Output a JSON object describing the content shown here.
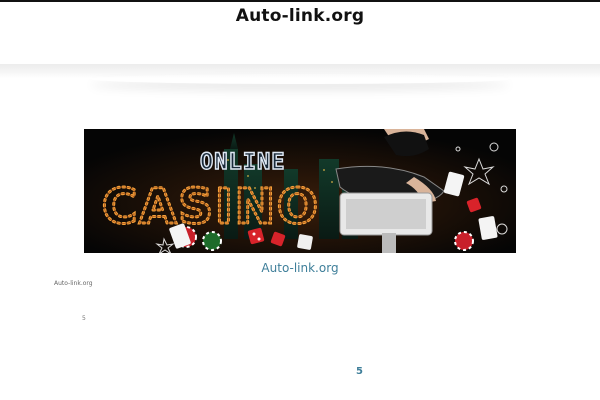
{
  "header": {
    "site_title": "Auto-link.org"
  },
  "banner": {
    "word_top": "ONLINE",
    "word_main": "CASINO",
    "caption": "Auto-link.org"
  },
  "content": {
    "small_site_label": "Auto-link.org",
    "small_number": "5"
  },
  "pagination": {
    "current": "5"
  },
  "colors": {
    "link": "#3f7f9a",
    "title": "#111111",
    "casino_lights": "#f6a13a"
  },
  "icons": [
    "dice-icon",
    "playing-card-icon",
    "casino-chip-icon"
  ]
}
